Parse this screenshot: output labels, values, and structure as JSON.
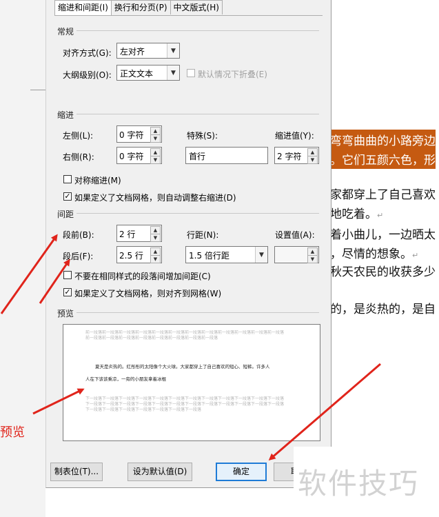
{
  "document": {
    "lines": [
      {
        "text": "弯弯曲曲的小路旁边",
        "highlight": true,
        "ret": false
      },
      {
        "text": "。它们五颜六色，形",
        "highlight": true,
        "ret": false
      },
      {
        "text": "家都穿上了自己喜欢",
        "highlight": false,
        "ret": false
      },
      {
        "text": "地吃着。",
        "highlight": false,
        "ret": true
      },
      {
        "text": "着小曲儿，一边晒太",
        "highlight": false,
        "ret": false
      },
      {
        "text": "，尽情的想象。",
        "highlight": false,
        "ret": true
      },
      {
        "text": "秋天农民的收获多少",
        "highlight": false,
        "ret": false
      },
      {
        "text": "的，是炎热的，是自",
        "highlight": false,
        "ret": false
      }
    ],
    "return_mark": "↵",
    "highlight_color": "#c55a11"
  },
  "dialog": {
    "tabs": [
      "缩进和间距(I)",
      "换行和分页(P)",
      "中文版式(H)"
    ],
    "active_tab": 0,
    "general": {
      "title": "常规",
      "alignment_label": "对齐方式(G):",
      "alignment_value": "左对齐",
      "outline_label": "大纲级别(O):",
      "outline_value": "正文文本",
      "collapse_label": "默认情况下折叠(E)"
    },
    "indent": {
      "title": "缩进",
      "left_label": "左侧(L):",
      "left_value": "0 字符",
      "right_label": "右侧(R):",
      "right_value": "0 字符",
      "special_label": "特殊(S):",
      "special_value": "首行",
      "by_label": "缩进值(Y):",
      "by_value": "2 字符",
      "mirror_label": "对称缩进(M)",
      "auto_adjust_label": "如果定义了文档网格，则自动调整右缩进(D)"
    },
    "spacing": {
      "title": "间距",
      "before_label": "段前(B):",
      "before_value": "2 行",
      "after_label": "段后(F):",
      "after_value": "2.5 行",
      "line_label": "行距(N):",
      "line_value": "1.5 倍行距",
      "at_label": "设置值(A):",
      "at_value": "",
      "no_space_label": "不要在相同样式的段落间增加间距(C)",
      "snap_grid_label": "如果定义了文档网格，则对齐到网格(W)"
    },
    "preview": {
      "title": "预览",
      "before_text": "前一段落前一段落前一段落前一段落前一段落前一段落前一段落前一段落前一段落前一段落前一段落前一段落前一段落前一段落前一段落前一段落前一段落前一段落前一段落前一段落",
      "body_line1": "夏天是炎热的。红彤彤的太阳像个大火球。大家都穿上了自己喜欢的短心、短裤。许多人",
      "body_line2": "人在下该该乘凉，一旁的小朋友拿着冰棍",
      "after_text": "下一段落下一段落下一段落下一段落下一段落下一段落下一段落下一段落下一段落下一段落下一段落下一段落下一段落下一段落下一段落下一段落下一段落下一段落下一段落下一段落下一段落下一段落下一段落下一段落下一段落下一段落下一段落下一段落下一段落下一段落下一段落"
    },
    "buttons": {
      "tabs": "制表位(T)...",
      "default": "设为默认值(D)",
      "ok": "确定",
      "cancel": "取"
    }
  },
  "annotation": {
    "label": "预览",
    "color": "#e0241b"
  },
  "watermark": "软件技巧"
}
